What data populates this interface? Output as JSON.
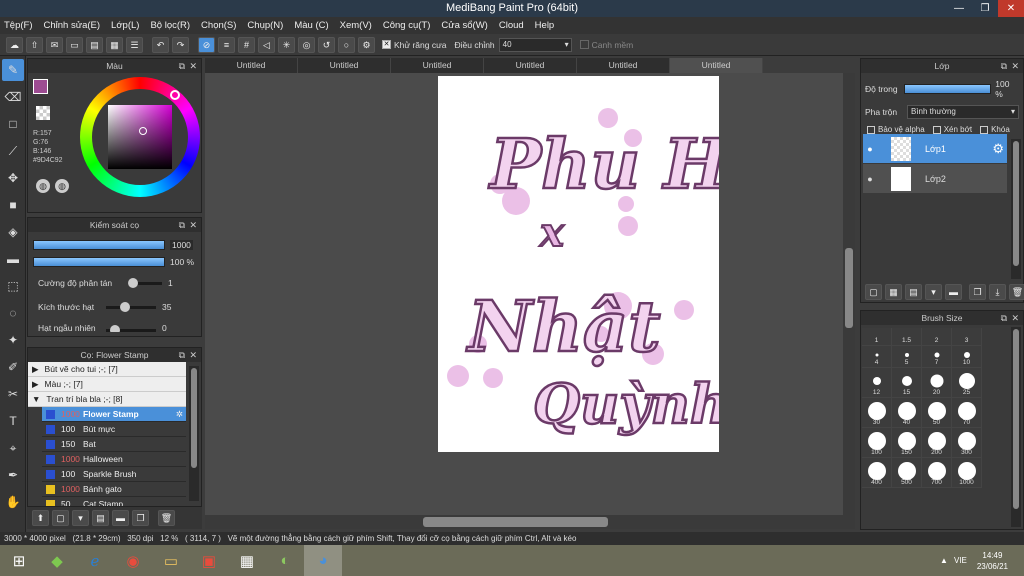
{
  "window": {
    "title": "MediBang Paint Pro (64bit)",
    "min": "—",
    "max": "❐",
    "close": "✕"
  },
  "menu": [
    "Tệp(F)",
    "Chỉnh sửa(E)",
    "Lớp(L)",
    "Bộ lọc(R)",
    "Chọn(S)",
    "Chụp(N)",
    "Màu (C)",
    "Xem(V)",
    "Công cụ(T)",
    "Cửa sổ(W)",
    "Cloud",
    "Help"
  ],
  "toolbar": {
    "antialias_label": "Khử răng cưa",
    "adjust_label": "Điều chỉnh",
    "adjust_value": "40",
    "snap_label": "Canh mềm"
  },
  "color_panel": {
    "title": "Màu",
    "r": "R:157",
    "g": "G:76",
    "b": "B:146",
    "hex": "#9D4C92"
  },
  "brush_control": {
    "title": "Kiểm soát cọ",
    "size": "1000",
    "opacity": "100 %",
    "scatter_label": "Cường độ phân tán",
    "scatter_value": "1",
    "grain_label": "Kích thước hạt",
    "grain_value": "35",
    "random_label": "Hạt ngẫu nhiên",
    "random_value": "0"
  },
  "brush_list": {
    "title": "Cọ: Flower Stamp",
    "groups": [
      "Bút vẽ cho tui ;-; [7]",
      "Màu ;-; [7]",
      "Tran trí bla bla ;-; [8]"
    ],
    "items": [
      {
        "size": "1000",
        "name": "Flower Stamp"
      },
      {
        "size": "100",
        "name": "Bút mực"
      },
      {
        "size": "150",
        "name": "Bat"
      },
      {
        "size": "1000",
        "name": "Halloween"
      },
      {
        "size": "100",
        "name": "Sparkle Brush"
      },
      {
        "size": "1000",
        "name": "Bánh gato"
      },
      {
        "size": "50",
        "name": "Cat Stamp"
      }
    ]
  },
  "tabs": [
    "Untitled",
    "Untitled",
    "Untitled",
    "Untitled",
    "Untitled",
    "Untitled"
  ],
  "artwork": {
    "line1": "Phu Hạc",
    "line2": "x",
    "line3": "Nhật",
    "line4": "Quỳnh"
  },
  "layer_panel": {
    "title": "Lớp",
    "opacity_label": "Độ trong",
    "opacity_value": "100 %",
    "blend_label": "Pha trộn",
    "blend_value": "Bình thường",
    "protect_alpha": "Bảo vệ alpha",
    "clipping": "Xén bớt",
    "lock": "Khóa",
    "layers": [
      "Lớp1",
      "Lớp2"
    ]
  },
  "brush_size_panel": {
    "title": "Brush Size",
    "sizes": [
      "1",
      "1.5",
      "2",
      "3",
      "4",
      "5",
      "7",
      "10",
      "12",
      "15",
      "20",
      "25",
      "30",
      "40",
      "50",
      "70",
      "100",
      "150",
      "200",
      "300",
      "400",
      "500",
      "700",
      "1000"
    ]
  },
  "status": {
    "dims": "3000 * 4000 pixel",
    "cm": "(21.8 * 29cm)",
    "dpi": "350 dpi",
    "zoom": "12 %",
    "coords": "( 3114, 7 )",
    "hint": "Vẽ một đường thẳng bằng cách giữ phím Shift, Thay đổi cỡ cọ bằng cách giữ phím Ctrl, Alt và kéo"
  },
  "taskbar": {
    "lang": "VIE",
    "time": "14:49",
    "date": "23/06/21"
  },
  "colors": {
    "accent": "#4a90d9",
    "ink": "#6b3a68",
    "pink": "#e8b6e3"
  }
}
